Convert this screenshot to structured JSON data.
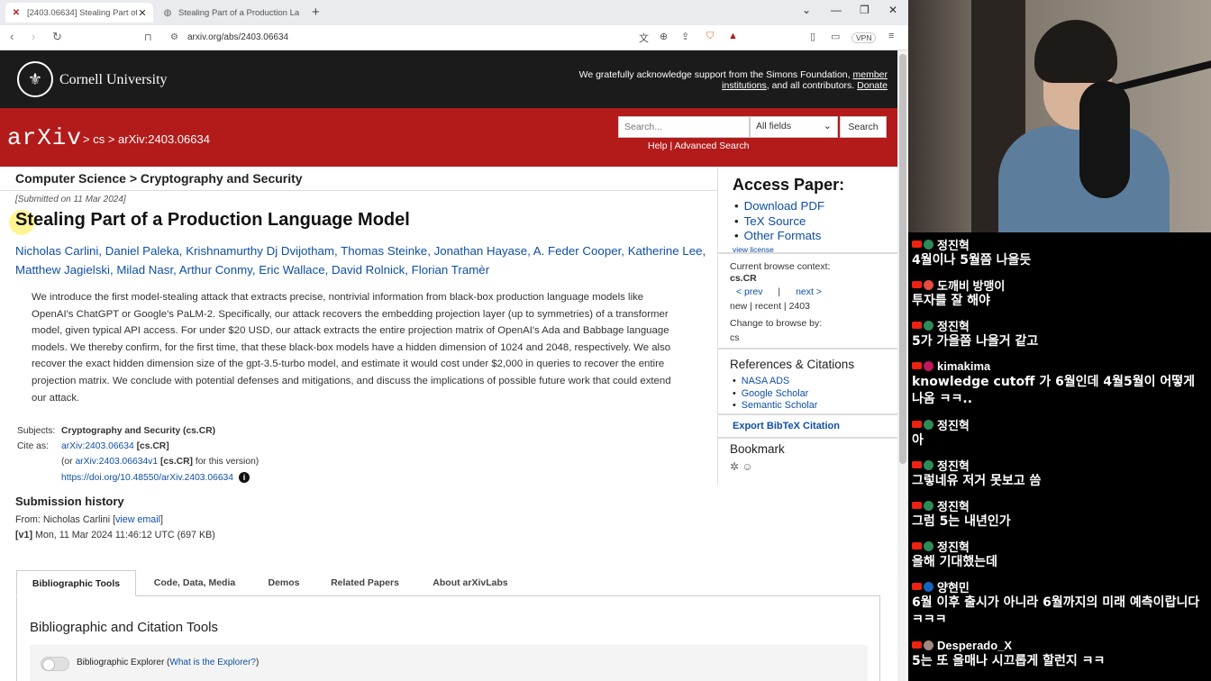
{
  "browser": {
    "tabs": [
      {
        "title": "[2403.06634] Stealing Part of a",
        "active": true
      },
      {
        "title": "Stealing Part of a Production Lang",
        "active": false
      }
    ],
    "url": "arxiv.org/abs/2403.06634",
    "vpn_label": "VPN",
    "new_tab": "+"
  },
  "cornell": {
    "name": "Cornell University",
    "ack_text": "We gratefully acknowledge support from the Simons Foundation, ",
    "ack_link1": "member institutions",
    "ack_mid": ", and all contributors. ",
    "ack_link2": "Donate"
  },
  "header": {
    "logo": "arXiv",
    "breadcrumb": "> cs > arXiv:2403.06634",
    "search_placeholder": "Search...",
    "search_field": "All fields",
    "search_button": "Search",
    "help_links": "Help | Advanced Search"
  },
  "paper": {
    "subject_header": "Computer Science > Cryptography and Security",
    "submitted": "[Submitted on 11 Mar 2024]",
    "title": "Stealing Part of a Production Language Model",
    "authors": "Nicholas Carlini, Daniel Paleka, Krishnamurthy Dj Dvijotham, Thomas Steinke, Jonathan Hayase, A. Feder Cooper, Katherine Lee, Matthew Jagielski, Milad Nasr, Arthur Conmy, Eric Wallace, David Rolnick, Florian Tramèr",
    "abstract": "We introduce the first model-stealing attack that extracts precise, nontrivial information from black-box production language models like OpenAI's ChatGPT or Google's PaLM-2. Specifically, our attack recovers the embedding projection layer (up to symmetries) of a transformer model, given typical API access. For under $20 USD, our attack extracts the entire projection matrix of OpenAI's Ada and Babbage language models. We thereby confirm, for the first time, that these black-box models have a hidden dimension of 1024 and 2048, respectively. We also recover the exact hidden dimension size of the gpt-3.5-turbo model, and estimate it would cost under $2,000 in queries to recover the entire projection matrix. We conclude with potential defenses and mitigations, and discuss the implications of possible future work that could extend our attack.",
    "subjects_label": "Subjects:",
    "subjects_value": "Cryptography and Security (cs.CR)",
    "cite_label": "Cite as:",
    "cite_id": "arXiv:2403.06634",
    "cite_tag": "[cs.CR]",
    "cite_or": "(or ",
    "cite_v1": "arXiv:2403.06634v1",
    "cite_v1_tag": "[cs.CR]",
    "cite_v1_suffix": " for this version)",
    "doi": "https://doi.org/10.48550/arXiv.2403.06634",
    "history_title": "Submission history",
    "history_from": "From: Nicholas Carlini [",
    "history_view_email": "view email",
    "history_from_end": "]",
    "history_v1_tag": "[v1]",
    "history_v1": " Mon, 11 Mar 2024 11:46:12 UTC (697 KB)"
  },
  "paper_tabs": [
    "Bibliographic Tools",
    "Code, Data, Media",
    "Demos",
    "Related Papers",
    "About arXivLabs"
  ],
  "panel": {
    "title": "Bibliographic and Citation Tools",
    "explorer_label": "Bibliographic Explorer (",
    "explorer_link": "What is the Explorer?",
    "explorer_end": ")"
  },
  "sidebar": {
    "access_title": "Access Paper:",
    "access_links": [
      "Download PDF",
      "TeX Source",
      "Other Formats"
    ],
    "view_license": "view license",
    "context_label": "Current browse context:",
    "context_value": "cs.CR",
    "prev": "< prev",
    "sep": "|",
    "next": "next >",
    "new_recent": "new | recent | 2403",
    "change_label": "Change to browse by:",
    "change_value": "cs",
    "ref_title": "References & Citations",
    "ref_links": [
      "NASA ADS",
      "Google Scholar",
      "Semantic Scholar"
    ],
    "bibtex": "Export BibTeX Citation",
    "bookmark": "Bookmark"
  },
  "chat": [
    {
      "user": "정진혁",
      "color": "#ffffff",
      "avatar": "#2e8b57",
      "text": "4월이나 5월쯤 나올듯"
    },
    {
      "user": "도깨비 방맹이",
      "color": "#ffffff",
      "avatar": "#e74c3c",
      "text": "투자를 잘 해야"
    },
    {
      "user": "정진혁",
      "color": "#ffffff",
      "avatar": "#2e8b57",
      "text": "5가 가을쯤 나올거 같고"
    },
    {
      "user": "kimakima",
      "color": "#ffffff",
      "avatar": "#c2185b",
      "text": "knowledge cutoff 가 6월인데 4월5월이 어떻게 나옴 ㅋㅋ.."
    },
    {
      "user": "정진혁",
      "color": "#ffffff",
      "avatar": "#2e8b57",
      "text": "아"
    },
    {
      "user": "정진혁",
      "color": "#ffffff",
      "avatar": "#2e8b57",
      "text": "그렇네유 저거 못보고 씀"
    },
    {
      "user": "정진혁",
      "color": "#ffffff",
      "avatar": "#2e8b57",
      "text": "그럼 5는 내년인가"
    },
    {
      "user": "정진혁",
      "color": "#ffffff",
      "avatar": "#2e8b57",
      "text": "올해 기대했는데"
    },
    {
      "user": "양현민",
      "color": "#ffffff",
      "avatar": "#1565c0",
      "text": "6월 이후 출시가 아니라 6월까지의 미래 예측이랍니다 ㅋㅋㅋ"
    },
    {
      "user": "Desperado_X",
      "color": "#ffffff",
      "avatar": "#a1887f",
      "text": "5는 또 올매나 시끄롭게 할런지 ㅋㅋ"
    }
  ]
}
